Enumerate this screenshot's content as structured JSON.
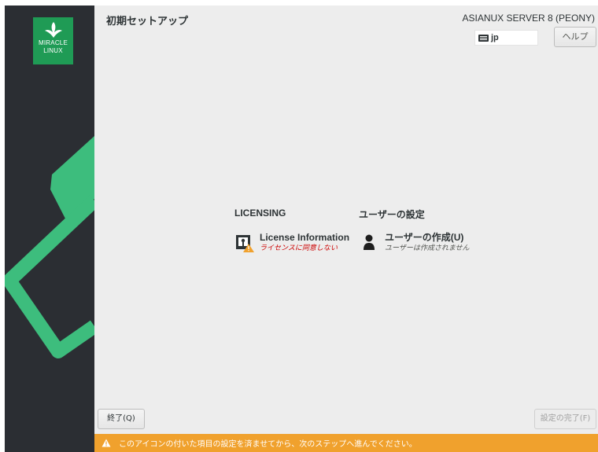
{
  "app": {
    "page_title": "初期セットアップ",
    "product_name": "ASIANUX SERVER 8 (PEONY)",
    "logo": {
      "line1": "MIRACLE",
      "line2": "LINUX",
      "icon": "miracle-linux-leaf-logo"
    }
  },
  "keyboard": {
    "value": "jp",
    "icon": "keyboard-icon"
  },
  "help_button": {
    "label": "ヘルプ"
  },
  "categories": [
    {
      "heading": "LICENSING",
      "items": [
        {
          "title": "License Information",
          "status": "ライセンスに同意しない",
          "icon": "license-warning-icon",
          "status_type": "warning"
        }
      ]
    },
    {
      "heading": "ユーザーの設定",
      "items": [
        {
          "title": "ユーザーの作成(U)",
          "status": "ユーザーは作成されません",
          "icon": "user-icon",
          "status_type": "normal"
        }
      ]
    }
  ],
  "footer": {
    "quit_label": "終了(Q)",
    "finish_label": "設定の完了(F)",
    "warning_text": "このアイコンの付いた項目の設定を済ませてから、次のステップへ進んでください。"
  },
  "colors": {
    "sidebar_bg": "#2b2e33",
    "accent_green": "#3dbd7d",
    "logo_green": "#1f9b55",
    "warning_bar": "#f0a12d",
    "warning_text": "#cc0000",
    "content_bg": "#ededed"
  }
}
